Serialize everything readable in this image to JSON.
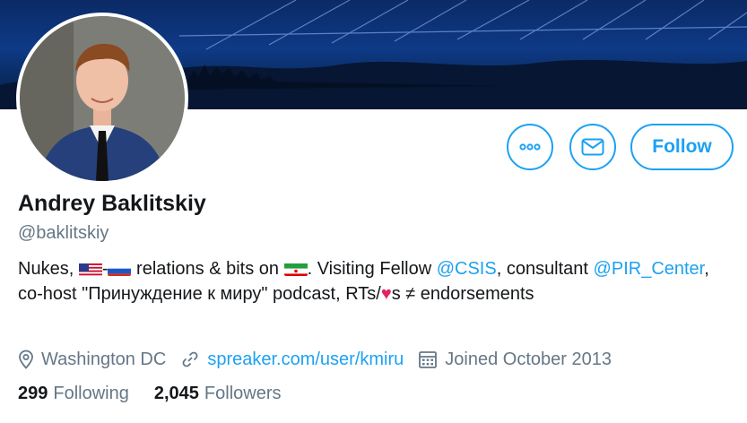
{
  "profile": {
    "name": "Andrey Baklitskiy",
    "handle": "@baklitskiy",
    "bio": {
      "part1": "Nukes, ",
      "dash": "-",
      "part2": " relations & bits on ",
      "part3": ". Visiting Fellow ",
      "mention_csis": "@CSIS",
      "part4": ",  consultant ",
      "mention_pir": "@PIR_Center",
      "part5": ", co-host \"Принуждение к миру\" podcast, RTs/",
      "heart": "♥",
      "part6": "s ≠ endorsements"
    },
    "location": "Washington DC",
    "website": "spreaker.com/user/kmiru",
    "joined": "Joined October 2013"
  },
  "actions": {
    "follow_label": "Follow"
  },
  "stats": {
    "following_count": "299",
    "following_label": "Following",
    "followers_count": "2,045",
    "followers_label": "Followers"
  },
  "icons": {
    "more": "more-icon",
    "message": "envelope-icon",
    "location": "location-pin-icon",
    "link": "link-icon",
    "calendar": "calendar-icon"
  },
  "colors": {
    "accent": "#1da1f2",
    "text": "#14171a",
    "muted": "#657786",
    "heart": "#e0245e"
  }
}
